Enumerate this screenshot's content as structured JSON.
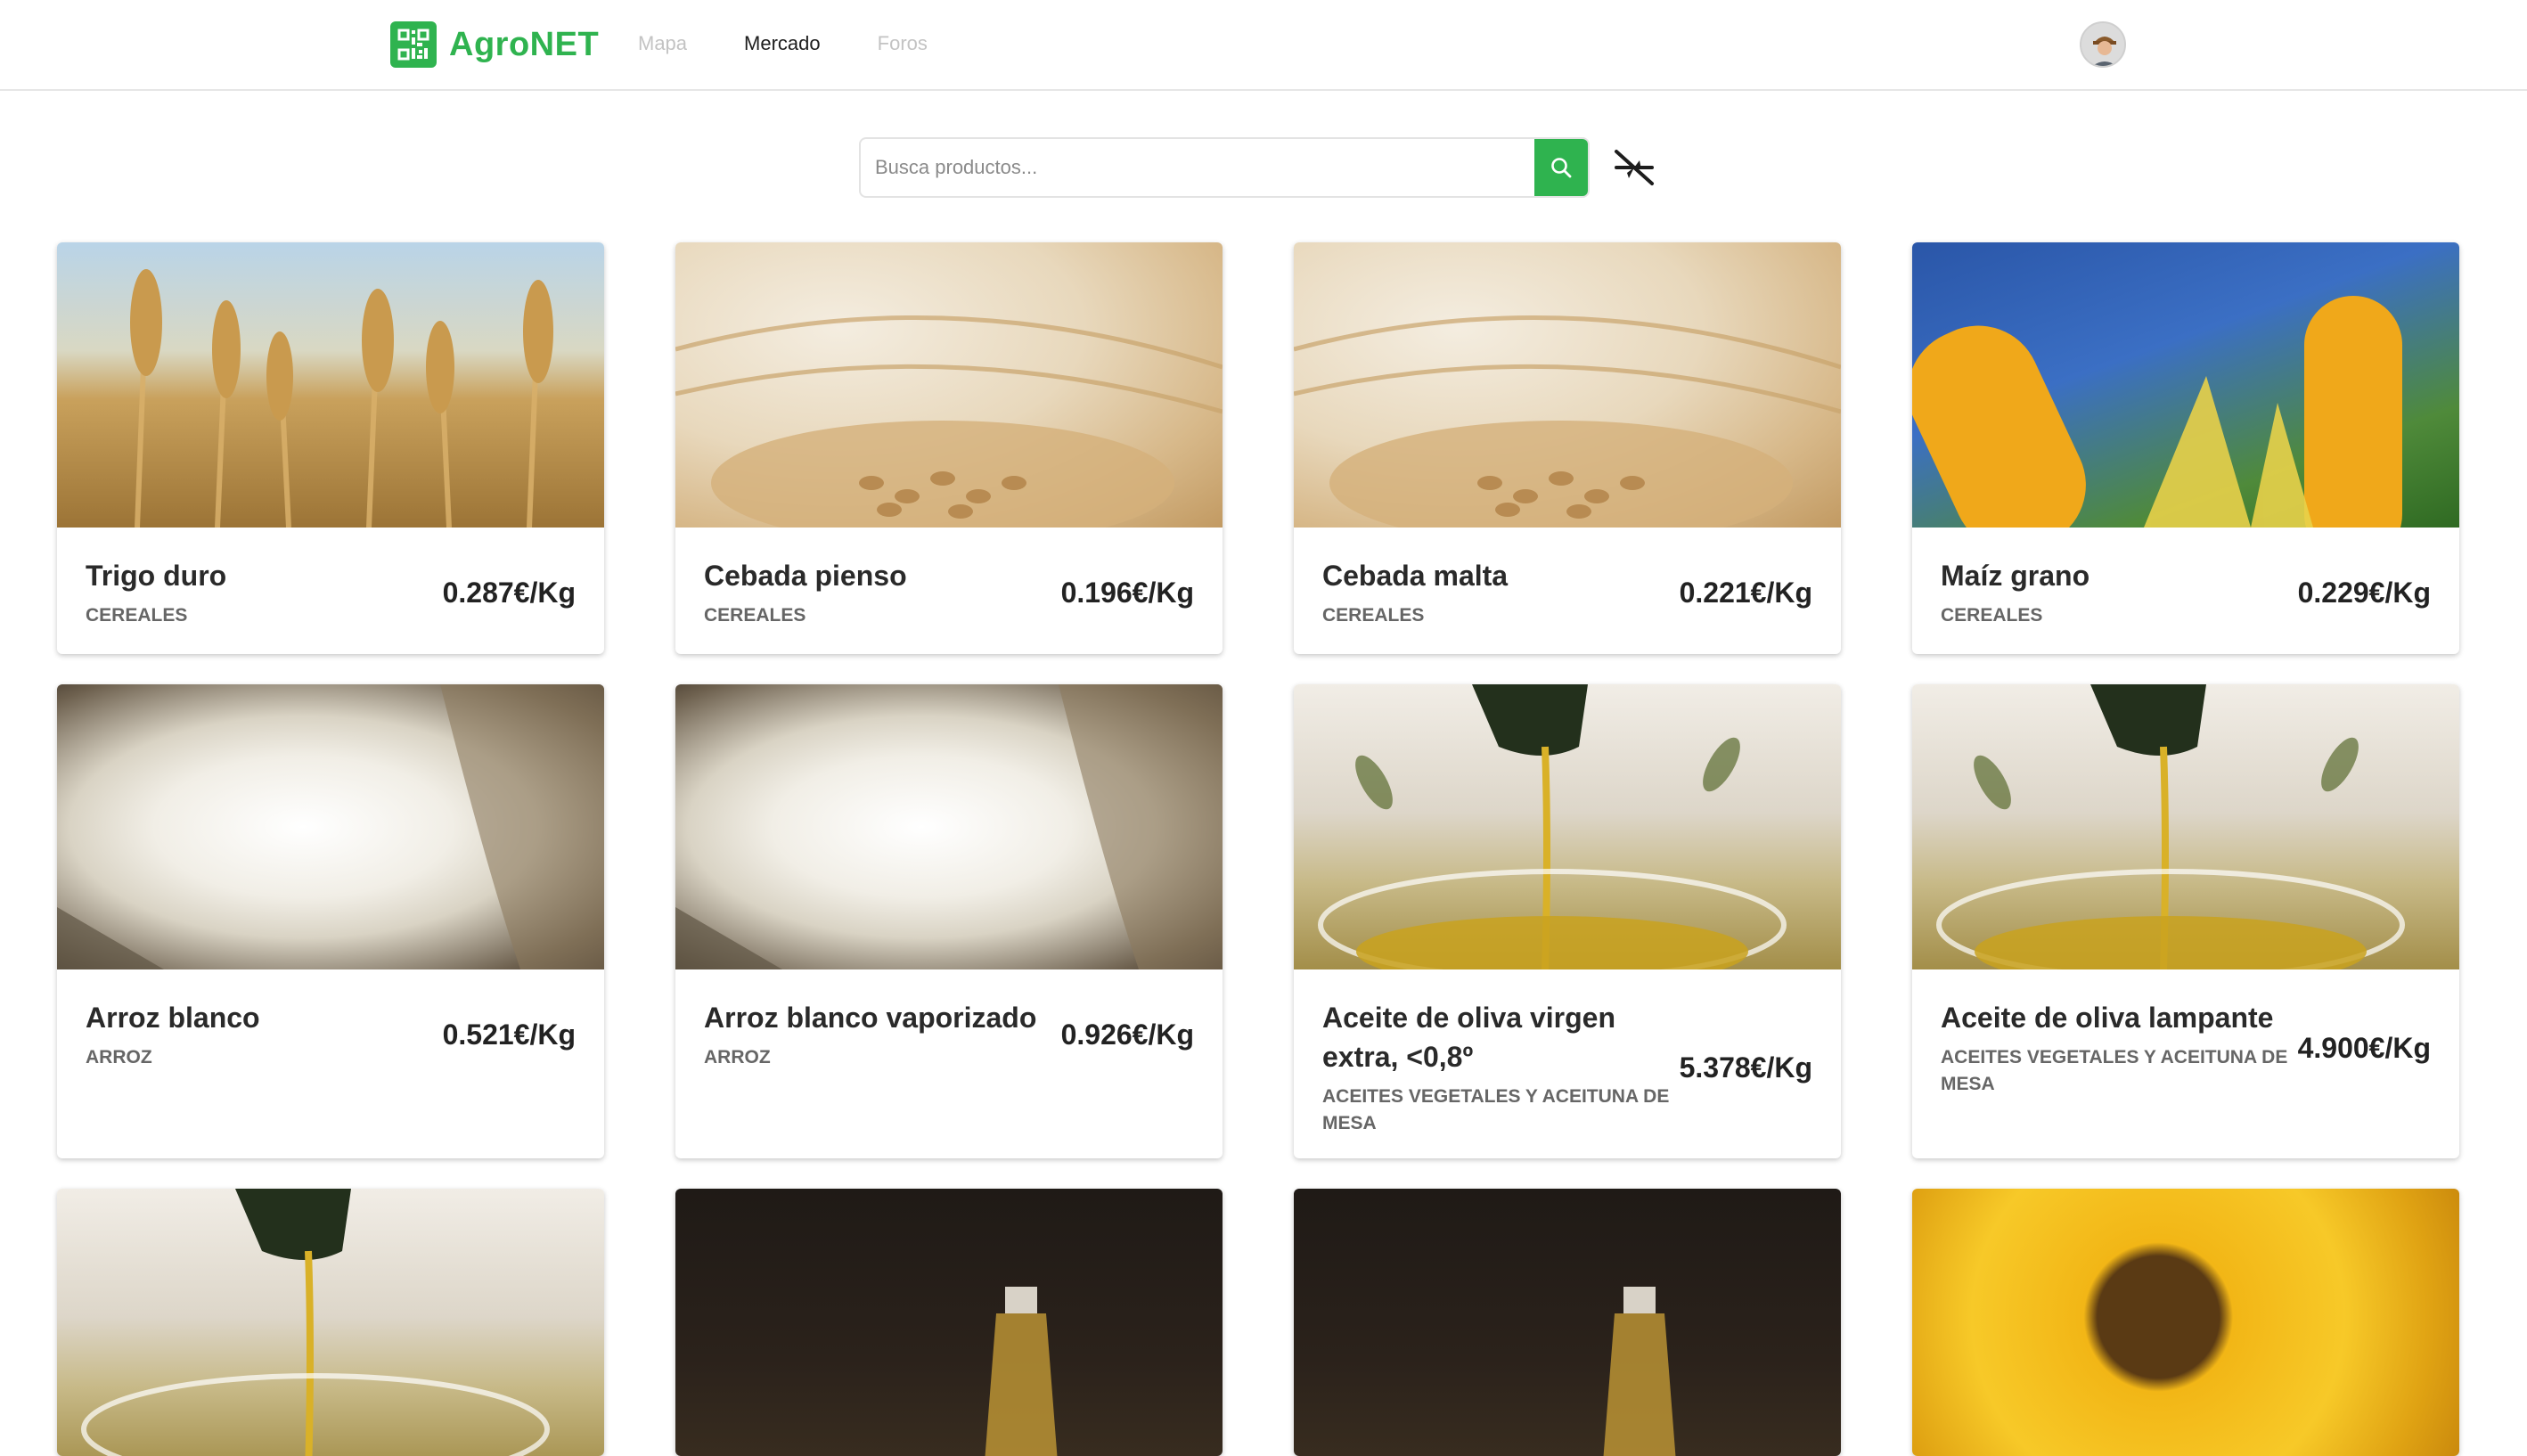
{
  "header": {
    "logo_text": "AgroNET",
    "nav": [
      {
        "label": "Mapa",
        "active": false
      },
      {
        "label": "Mercado",
        "active": true
      },
      {
        "label": "Foros",
        "active": false
      }
    ],
    "avatar_icon": "user-avatar-icon"
  },
  "search": {
    "placeholder": "Busca productos...",
    "value": "",
    "button_icon": "search-icon",
    "filter_icon": "filter-arrows-icon"
  },
  "colors": {
    "brand": "#2fb34f",
    "nav_inactive": "#c3c3c3",
    "nav_active": "#1e1e1e"
  },
  "products": [
    {
      "name": "Trigo duro",
      "category": "CEREALES",
      "price": "0.287€/Kg",
      "image": "wheat-field"
    },
    {
      "name": "Cebada pienso",
      "category": "CEREALES",
      "price": "0.196€/Kg",
      "image": "barley-grains"
    },
    {
      "name": "Cebada malta",
      "category": "CEREALES",
      "price": "0.221€/Kg",
      "image": "barley-grains"
    },
    {
      "name": "Maíz grano",
      "category": "CEREALES",
      "price": "0.229€/Kg",
      "image": "corn-cobs"
    },
    {
      "name": "Arroz blanco",
      "category": "ARROZ",
      "price": "0.521€/Kg",
      "image": "white-rice"
    },
    {
      "name": "Arroz blanco vaporizado",
      "category": "ARROZ",
      "price": "0.926€/Kg",
      "image": "white-rice"
    },
    {
      "name": "Aceite de oliva virgen extra, <0,8º",
      "category": "ACEITES VEGETALES Y ACEITUNA DE MESA",
      "price": "5.378€/Kg",
      "image": "olive-oil-pour"
    },
    {
      "name": "Aceite de oliva lampante",
      "category": "ACEITES VEGETALES Y ACEITUNA DE MESA",
      "price": "4.900€/Kg",
      "image": "olive-oil-pour"
    }
  ],
  "partial_cards": [
    {
      "image": "olive-oil-pour"
    },
    {
      "image": "oil-bottle-dark"
    },
    {
      "image": "oil-bottle-dark"
    },
    {
      "image": "sunflower"
    }
  ]
}
